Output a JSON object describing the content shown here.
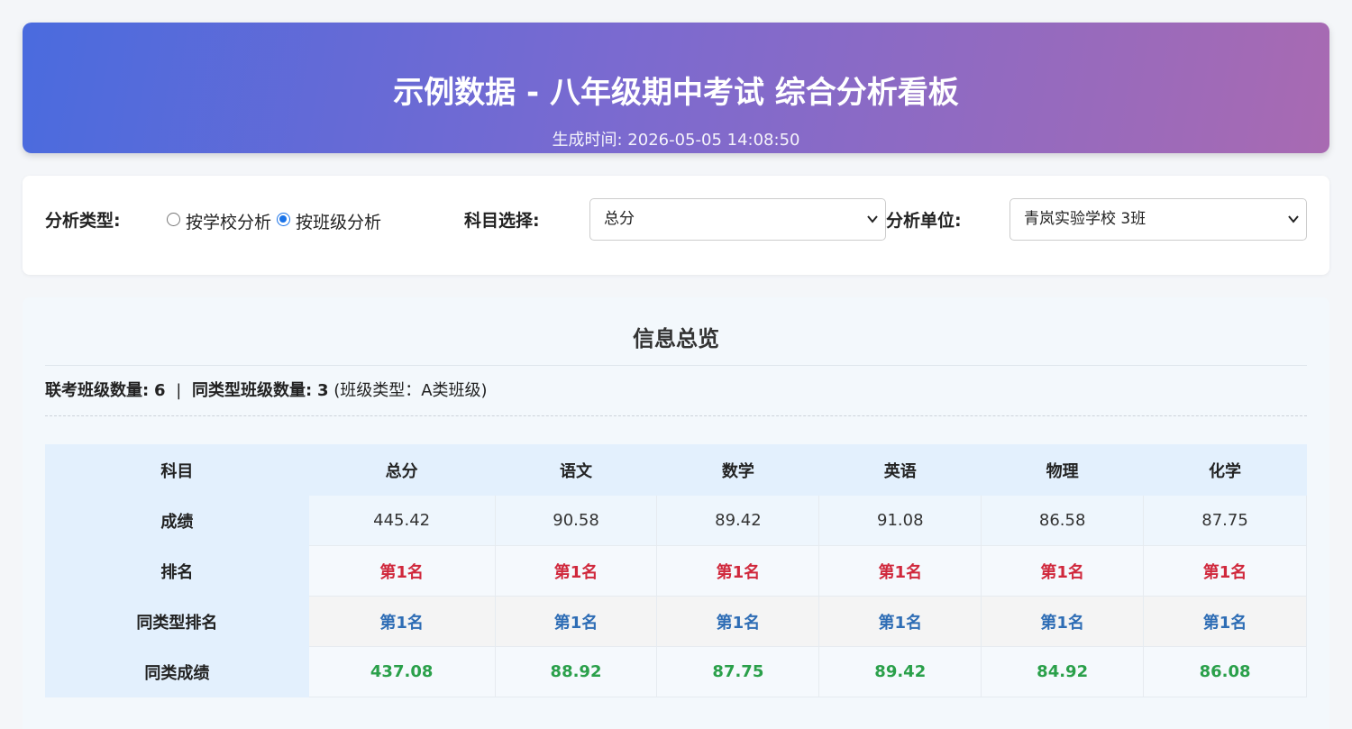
{
  "header": {
    "title": "示例数据 - 八年级期中考试 综合分析看板",
    "generated": "生成时间: 2026-05-05 14:08:50"
  },
  "controls": {
    "analysis_type_label": "分析类型:",
    "radio_school": "按学校分析",
    "radio_class": "按班级分析",
    "selected_radio": "按班级分析",
    "subject_label": "科目选择:",
    "subject_value": "总分",
    "unit_label": "分析单位:",
    "unit_value": "青岚实验学校 3班"
  },
  "overview": {
    "title": "信息总览",
    "joint_label": "联考班级数量:",
    "joint_count": "6",
    "separator": "|",
    "same_type_label": "同类型班级数量:",
    "same_type_count": "3",
    "class_type": "(班级类型：A类班级)"
  },
  "table": {
    "header_label": "科目",
    "subjects": [
      "总分",
      "语文",
      "数学",
      "英语",
      "物理",
      "化学"
    ],
    "row_labels": [
      "成绩",
      "排名",
      "同类型排名",
      "同类成绩"
    ],
    "scores": [
      "445.42",
      "90.58",
      "89.42",
      "91.08",
      "86.58",
      "87.75"
    ],
    "ranks": [
      "第1名",
      "第1名",
      "第1名",
      "第1名",
      "第1名",
      "第1名"
    ],
    "type_ranks": [
      "第1名",
      "第1名",
      "第1名",
      "第1名",
      "第1名",
      "第1名"
    ],
    "type_scores": [
      "437.08",
      "88.92",
      "87.75",
      "89.42",
      "84.92",
      "86.08"
    ]
  },
  "colors": {
    "header_gradient_start": "#4a6bde",
    "header_gradient_end": "#a86ab2",
    "rank_red": "#d0283c",
    "type_rank_blue": "#2e6db5",
    "type_score_green": "#2aa04a"
  }
}
